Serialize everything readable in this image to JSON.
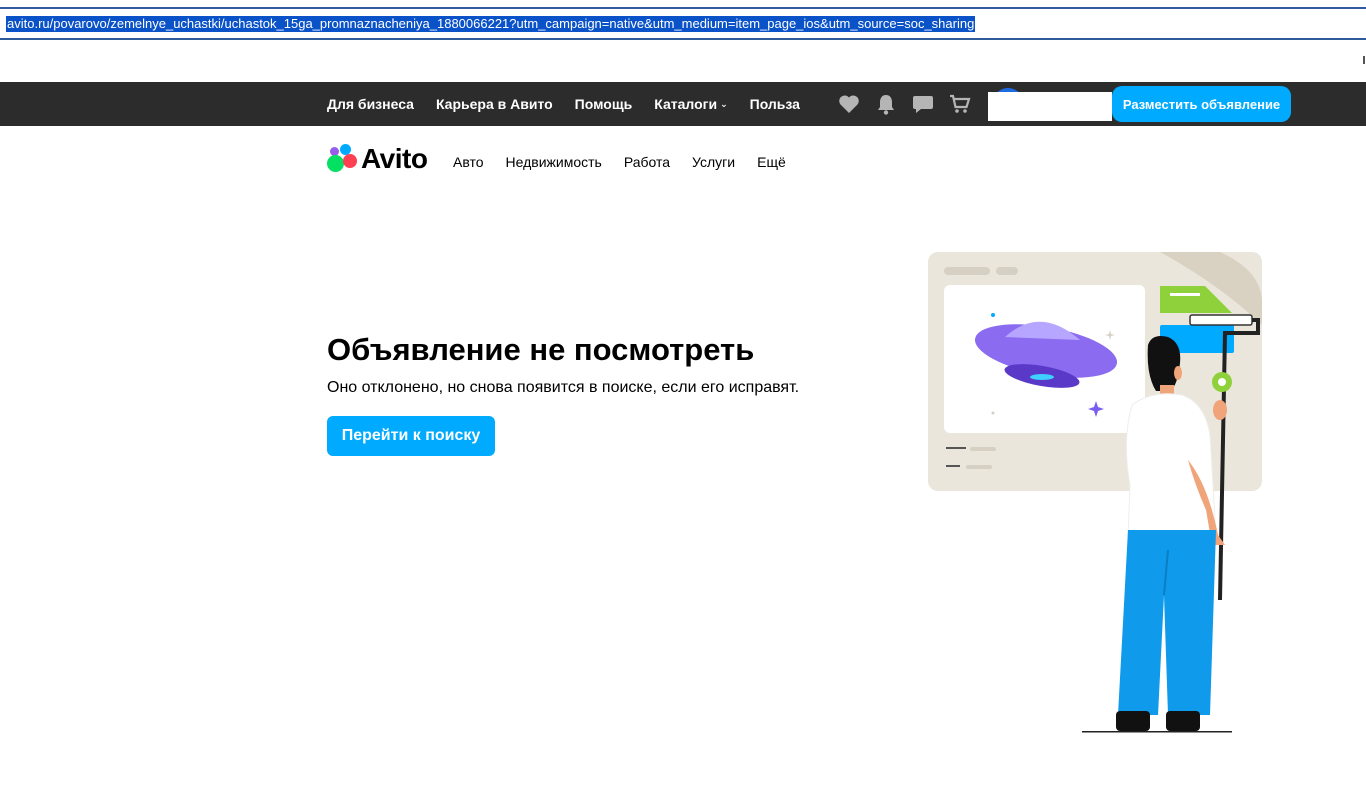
{
  "browser": {
    "url": "avito.ru/povarovo/zemelnye_uchastki/uchastok_15ga_promnaznacheniya_1880066221?utm_campaign=native&utm_medium=item_page_ios&utm_source=soc_sharing"
  },
  "topbar": {
    "links": [
      {
        "label": "Для бизнеса"
      },
      {
        "label": "Карьера в Авито"
      },
      {
        "label": "Помощь"
      },
      {
        "label": "Каталоги"
      },
      {
        "label": "Польза"
      }
    ],
    "icons": [
      "heart-icon",
      "bell-icon",
      "chat-icon",
      "cart-icon"
    ],
    "post_button": "Разместить объявление"
  },
  "header": {
    "logo_text": "Avito",
    "categories": [
      {
        "label": "Авто"
      },
      {
        "label": "Недвижимость"
      },
      {
        "label": "Работа"
      },
      {
        "label": "Услуги"
      },
      {
        "label": "Ещё"
      }
    ]
  },
  "main": {
    "title": "Объявление не посмотреть",
    "subtitle": "Оно отклонено, но снова появится в поиске, если его исправят.",
    "button": "Перейти к поиску"
  },
  "colors": {
    "accent": "#00aaff",
    "topbar": "#2c2c2c",
    "logo_green": "#04e061",
    "logo_blue": "#00aaff",
    "logo_red": "#ff4053",
    "logo_purple": "#965eeb"
  }
}
